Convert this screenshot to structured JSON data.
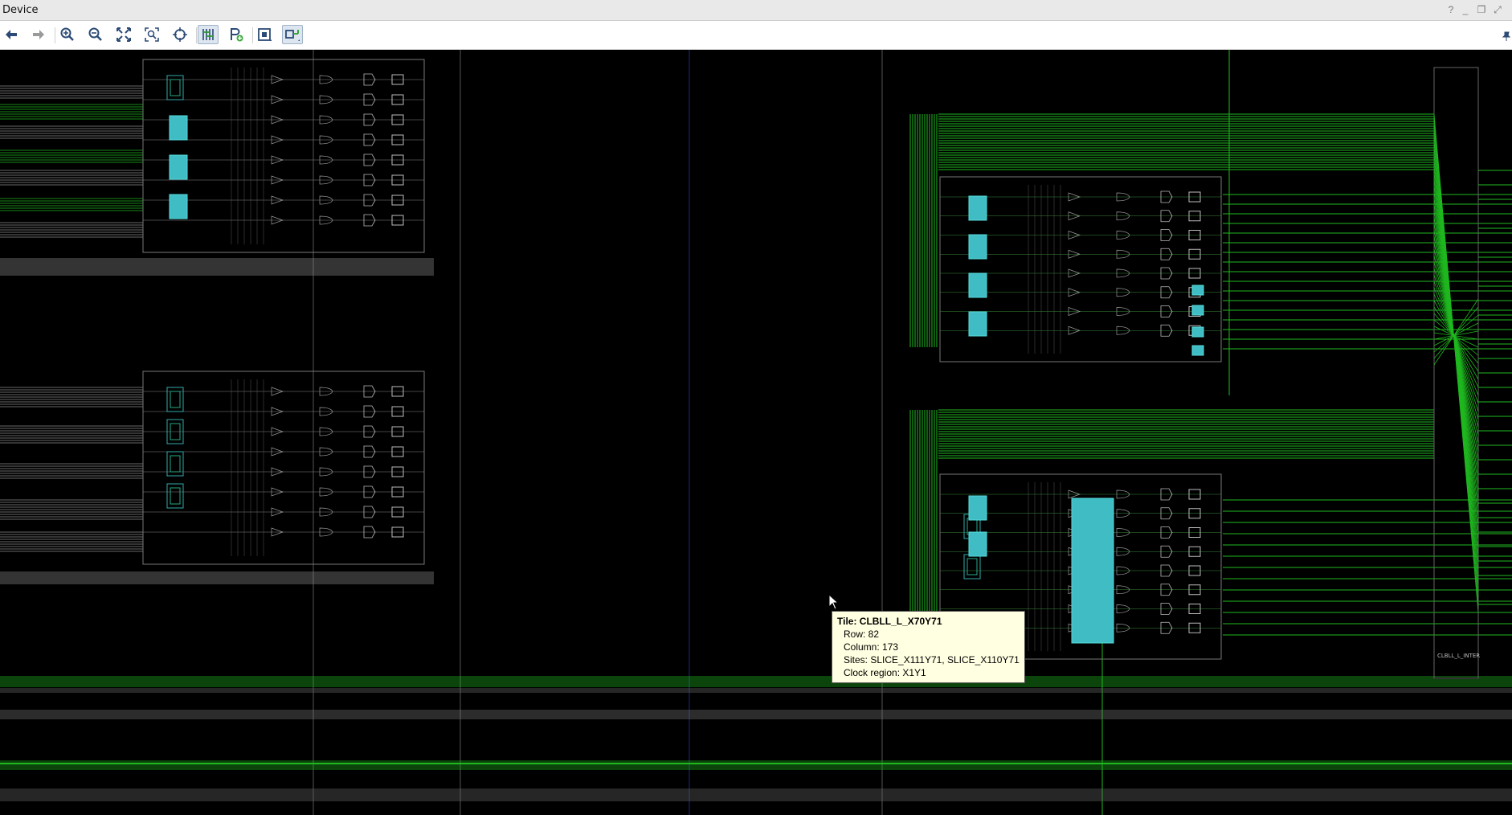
{
  "window": {
    "title": "Device"
  },
  "window_controls": {
    "help": "?",
    "minimize": "_",
    "restore": "❐",
    "maximize": "⤢"
  },
  "toolbar": {
    "buttons": [
      {
        "icon": "back-arrow-icon"
      },
      {
        "icon": "forward-arrow-icon"
      },
      {
        "icon": "zoom-in-icon"
      },
      {
        "icon": "zoom-out-icon"
      },
      {
        "icon": "zoom-fit-icon"
      },
      {
        "icon": "zoom-area-icon"
      },
      {
        "icon": "crosshair-icon"
      },
      {
        "icon": "routing-resources-icon",
        "active": true
      },
      {
        "icon": "add-pblock-icon"
      },
      {
        "icon": "site-view-icon"
      },
      {
        "icon": "tile-view-icon",
        "active": true
      }
    ],
    "pin_icon": "pin-icon"
  },
  "tooltip": {
    "title": "Tile: CLBLL_L_X70Y71",
    "lines": [
      "Row: 82",
      "Column: 173",
      "Sites: SLICE_X111Y71, SLICE_X110Y71",
      "Clock region: X1Y1"
    ]
  },
  "tile_labels": {
    "interconnect": "CLBLL_L_INTER"
  },
  "colors": {
    "background": "#000000",
    "net_green": "#1fb81f",
    "wire_gray": "#8a8a8a",
    "cell_cyan": "#3fbcc4",
    "tooltip_bg": "#ffffe1"
  }
}
